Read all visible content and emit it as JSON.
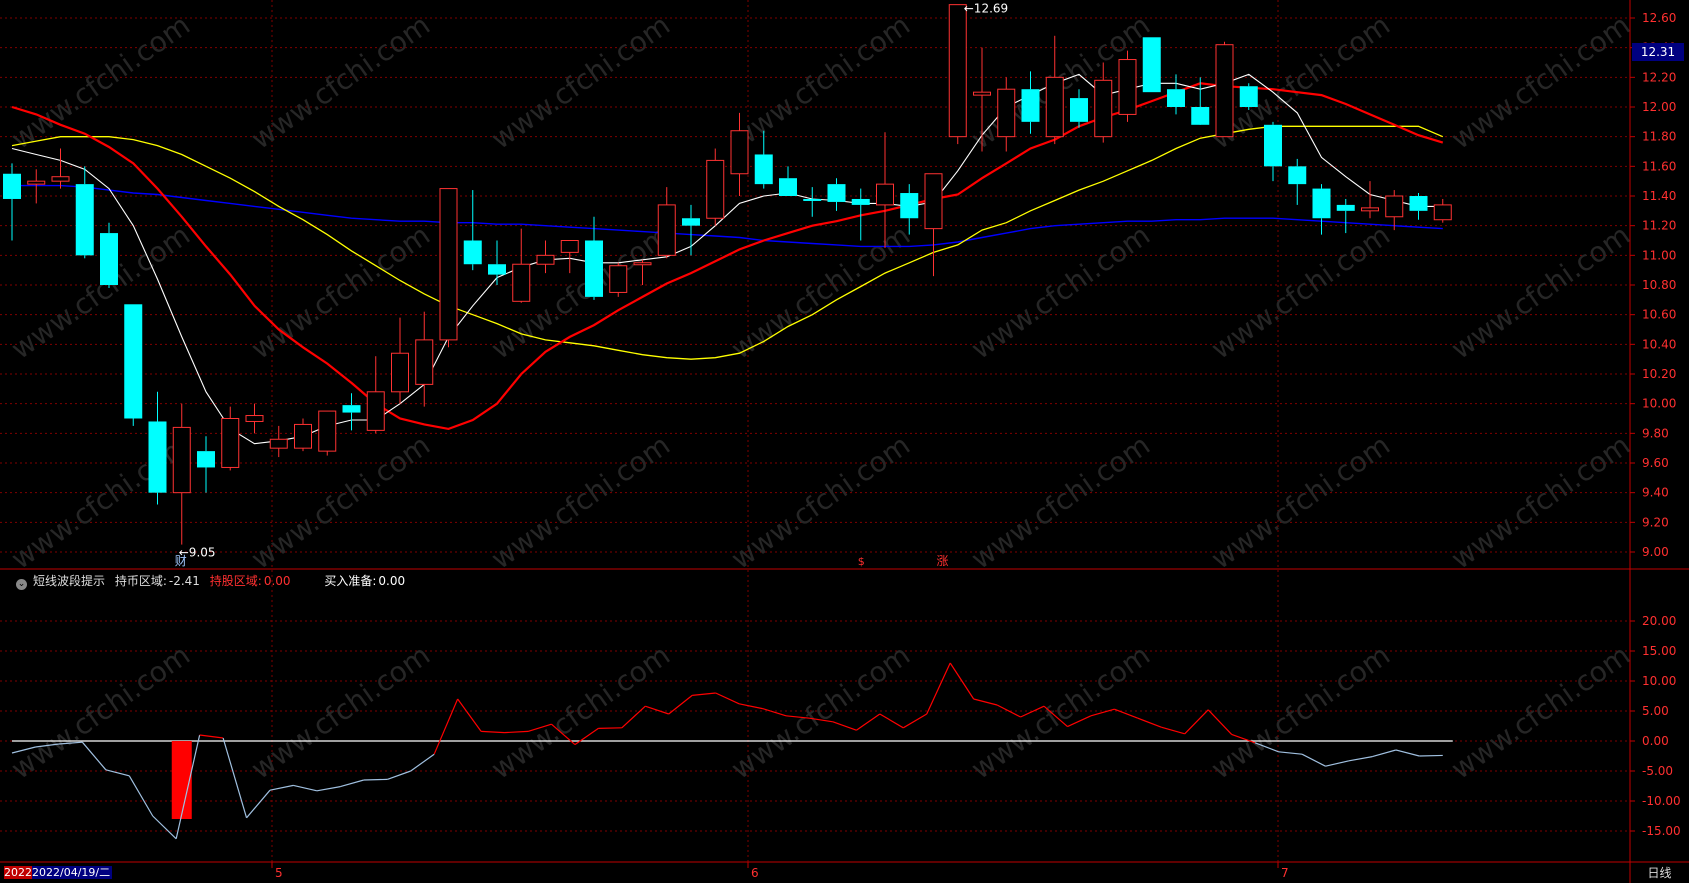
{
  "colors": {
    "up": "#ff3232",
    "down": "#00ffff",
    "ma5": "#ffffff",
    "ma10": "#ff0000",
    "ma20": "#ffff00",
    "ma60": "#0000ff",
    "grid": "#800000",
    "axis": "#c00000",
    "oscUp": "#ff0000",
    "oscDown": "#a0c0e0",
    "zero": "#ffffff",
    "bar": "#ff0000"
  },
  "price": {
    "last": "12.31",
    "max_label": "12.69",
    "min_label": "9.05",
    "ticks": [
      "12.60",
      "12.40",
      "12.20",
      "12.00",
      "11.80",
      "11.60",
      "11.40",
      "11.20",
      "11.00",
      "10.80",
      "10.60",
      "10.40",
      "10.20",
      "10.00",
      "9.80",
      "9.60",
      "9.40",
      "9.20",
      "9.00"
    ]
  },
  "indicator": {
    "name": "短线波段提示",
    "hold_coin_label": "持币区域:",
    "hold_coin_value": "-2.41",
    "hold_stock_label": "持股区域:",
    "hold_stock_value": "0.00",
    "buy_label": "买入准备:",
    "buy_value": "0.00",
    "ticks": [
      "20.00",
      "15.00",
      "10.00",
      "5.00",
      "0.00",
      "-5.00",
      "-10.00",
      "-15.00"
    ]
  },
  "bottom": {
    "year_fragment": "2022",
    "cursor_date": "2022/04/19/二",
    "months": [
      "5",
      "6",
      "7"
    ],
    "period": "日线"
  },
  "markers": {
    "cai": "财",
    "s": "$",
    "zhang": "涨"
  },
  "chart_data": [
    {
      "type": "candlestick",
      "title": "",
      "ylim": [
        9.0,
        12.7
      ],
      "ma_series": [
        "MA5",
        "MA10",
        "MA20",
        "MA60"
      ],
      "candles": [
        {
          "o": 11.55,
          "h": 11.62,
          "l": 11.1,
          "c": 11.38
        },
        {
          "o": 11.48,
          "h": 11.58,
          "l": 11.35,
          "c": 11.5
        },
        {
          "o": 11.5,
          "h": 11.72,
          "l": 11.45,
          "c": 11.53
        },
        {
          "o": 11.48,
          "h": 11.6,
          "l": 10.98,
          "c": 11.0
        },
        {
          "o": 11.15,
          "h": 11.22,
          "l": 10.78,
          "c": 10.8
        },
        {
          "o": 10.67,
          "h": 10.67,
          "l": 9.85,
          "c": 9.9
        },
        {
          "o": 9.88,
          "h": 10.08,
          "l": 9.32,
          "c": 9.4
        },
        {
          "o": 9.4,
          "h": 10.0,
          "l": 9.05,
          "c": 9.84
        },
        {
          "o": 9.68,
          "h": 9.78,
          "l": 9.4,
          "c": 9.57
        },
        {
          "o": 9.57,
          "h": 9.98,
          "l": 9.55,
          "c": 9.9
        },
        {
          "o": 9.88,
          "h": 10.0,
          "l": 9.8,
          "c": 9.92
        },
        {
          "o": 9.7,
          "h": 9.85,
          "l": 9.64,
          "c": 9.76
        },
        {
          "o": 9.7,
          "h": 9.9,
          "l": 9.68,
          "c": 9.86
        },
        {
          "o": 9.68,
          "h": 9.95,
          "l": 9.65,
          "c": 9.95
        },
        {
          "o": 9.99,
          "h": 10.07,
          "l": 9.82,
          "c": 9.94
        },
        {
          "o": 9.82,
          "h": 10.32,
          "l": 9.8,
          "c": 10.08
        },
        {
          "o": 10.08,
          "h": 10.58,
          "l": 10.0,
          "c": 10.34
        },
        {
          "o": 10.13,
          "h": 10.62,
          "l": 9.98,
          "c": 10.43
        },
        {
          "o": 10.43,
          "h": 11.45,
          "l": 10.38,
          "c": 11.45
        },
        {
          "o": 11.1,
          "h": 11.44,
          "l": 10.9,
          "c": 10.94
        },
        {
          "o": 10.94,
          "h": 11.1,
          "l": 10.8,
          "c": 10.87
        },
        {
          "o": 10.69,
          "h": 11.18,
          "l": 10.68,
          "c": 10.94
        },
        {
          "o": 10.94,
          "h": 11.1,
          "l": 10.88,
          "c": 11.0
        },
        {
          "o": 11.02,
          "h": 11.1,
          "l": 10.88,
          "c": 11.1
        },
        {
          "o": 11.1,
          "h": 11.26,
          "l": 10.7,
          "c": 10.72
        },
        {
          "o": 10.75,
          "h": 10.95,
          "l": 10.72,
          "c": 10.93
        },
        {
          "o": 10.95,
          "h": 10.97,
          "l": 10.8,
          "c": 10.95
        },
        {
          "o": 11.0,
          "h": 11.46,
          "l": 10.98,
          "c": 11.34
        },
        {
          "o": 11.25,
          "h": 11.34,
          "l": 11.0,
          "c": 11.2
        },
        {
          "o": 11.25,
          "h": 11.72,
          "l": 11.2,
          "c": 11.64
        },
        {
          "o": 11.55,
          "h": 11.96,
          "l": 11.4,
          "c": 11.84
        },
        {
          "o": 11.68,
          "h": 11.84,
          "l": 11.45,
          "c": 11.48
        },
        {
          "o": 11.52,
          "h": 11.6,
          "l": 11.4,
          "c": 11.4
        },
        {
          "o": 11.38,
          "h": 11.46,
          "l": 11.26,
          "c": 11.37
        },
        {
          "o": 11.48,
          "h": 11.52,
          "l": 11.3,
          "c": 11.36
        },
        {
          "o": 11.38,
          "h": 11.45,
          "l": 11.1,
          "c": 11.34
        },
        {
          "o": 11.34,
          "h": 11.83,
          "l": 11.05,
          "c": 11.48
        },
        {
          "o": 11.42,
          "h": 11.48,
          "l": 11.14,
          "c": 11.25
        },
        {
          "o": 11.18,
          "h": 11.55,
          "l": 10.86,
          "c": 11.55
        },
        {
          "o": 11.8,
          "h": 12.69,
          "l": 11.75,
          "c": 12.69
        },
        {
          "o": 12.08,
          "h": 12.4,
          "l": 11.7,
          "c": 12.1
        },
        {
          "o": 11.8,
          "h": 12.2,
          "l": 11.7,
          "c": 12.12
        },
        {
          "o": 12.12,
          "h": 12.24,
          "l": 11.82,
          "c": 11.9
        },
        {
          "o": 11.8,
          "h": 12.48,
          "l": 11.75,
          "c": 12.2
        },
        {
          "o": 12.06,
          "h": 12.12,
          "l": 11.86,
          "c": 11.9
        },
        {
          "o": 11.8,
          "h": 12.3,
          "l": 11.76,
          "c": 12.18
        },
        {
          "o": 11.95,
          "h": 12.38,
          "l": 11.9,
          "c": 12.32
        },
        {
          "o": 12.47,
          "h": 12.47,
          "l": 12.1,
          "c": 12.1
        },
        {
          "o": 12.12,
          "h": 12.22,
          "l": 11.95,
          "c": 12.0
        },
        {
          "o": 12.0,
          "h": 12.2,
          "l": 11.9,
          "c": 11.88
        },
        {
          "o": 11.8,
          "h": 12.44,
          "l": 11.8,
          "c": 12.42
        },
        {
          "o": 12.14,
          "h": 12.16,
          "l": 11.98,
          "c": 12.0
        },
        {
          "o": 11.88,
          "h": 11.9,
          "l": 11.5,
          "c": 11.6
        },
        {
          "o": 11.6,
          "h": 11.65,
          "l": 11.34,
          "c": 11.48
        },
        {
          "o": 11.45,
          "h": 11.48,
          "l": 11.14,
          "c": 11.25
        },
        {
          "o": 11.34,
          "h": 11.38,
          "l": 11.15,
          "c": 11.3
        },
        {
          "o": 11.3,
          "h": 11.5,
          "l": 11.25,
          "c": 11.32
        },
        {
          "o": 11.26,
          "h": 11.44,
          "l": 11.17,
          "c": 11.4
        },
        {
          "o": 11.4,
          "h": 11.42,
          "l": 11.24,
          "c": 11.3
        },
        {
          "o": 11.24,
          "h": 11.38,
          "l": 11.22,
          "c": 11.34
        }
      ],
      "ma5": [
        11.72,
        11.68,
        11.64,
        11.58,
        11.45,
        11.2,
        10.84,
        10.45,
        10.08,
        9.83,
        9.73,
        9.75,
        9.78,
        9.85,
        9.89,
        9.89,
        10.0,
        10.13,
        10.45,
        10.66,
        10.85,
        10.92,
        10.97,
        10.98,
        10.95,
        10.95,
        10.97,
        10.99,
        11.06,
        11.2,
        11.35,
        11.4,
        11.42,
        11.38,
        11.37,
        11.35,
        11.35,
        11.33,
        11.36,
        11.57,
        11.81,
        12.0,
        12.08,
        12.16,
        12.22,
        12.08,
        12.12,
        12.16,
        12.16,
        12.12,
        12.16,
        12.22,
        12.1,
        11.96,
        11.66,
        11.53,
        11.41,
        11.37,
        11.33,
        11.33
      ],
      "ma10": [
        12.0,
        11.95,
        11.88,
        11.82,
        11.73,
        11.62,
        11.45,
        11.26,
        11.06,
        10.87,
        10.66,
        10.5,
        10.38,
        10.27,
        10.14,
        10.0,
        9.9,
        9.86,
        9.83,
        9.89,
        10.0,
        10.2,
        10.35,
        10.45,
        10.53,
        10.63,
        10.72,
        10.81,
        10.88,
        10.96,
        11.04,
        11.1,
        11.15,
        11.2,
        11.23,
        11.27,
        11.3,
        11.34,
        11.38,
        11.41,
        11.52,
        11.62,
        11.72,
        11.78,
        11.87,
        11.93,
        11.98,
        12.04,
        12.1,
        12.16,
        12.14,
        12.13,
        12.12,
        12.1,
        12.08,
        12.02,
        11.95,
        11.88,
        11.81,
        11.76
      ],
      "ma20": [
        11.74,
        11.77,
        11.8,
        11.8,
        11.8,
        11.78,
        11.74,
        11.68,
        11.6,
        11.52,
        11.43,
        11.33,
        11.24,
        11.14,
        11.03,
        10.93,
        10.83,
        10.74,
        10.66,
        10.6,
        10.54,
        10.47,
        10.43,
        10.41,
        10.39,
        10.36,
        10.33,
        10.31,
        10.3,
        10.31,
        10.34,
        10.42,
        10.52,
        10.6,
        10.7,
        10.79,
        10.88,
        10.95,
        11.02,
        11.07,
        11.17,
        11.22,
        11.3,
        11.37,
        11.44,
        11.5,
        11.57,
        11.64,
        11.72,
        11.79,
        11.82,
        11.85,
        11.87,
        11.87,
        11.87,
        11.87,
        11.87,
        11.87,
        11.87,
        11.8
      ],
      "ma60": [
        11.47,
        11.47,
        11.47,
        11.46,
        11.44,
        11.42,
        11.41,
        11.39,
        11.37,
        11.35,
        11.33,
        11.31,
        11.29,
        11.27,
        11.25,
        11.24,
        11.23,
        11.23,
        11.22,
        11.22,
        11.21,
        11.21,
        11.2,
        11.19,
        11.18,
        11.17,
        11.16,
        11.15,
        11.14,
        11.13,
        11.12,
        11.1,
        11.09,
        11.08,
        11.07,
        11.06,
        11.06,
        11.06,
        11.07,
        11.09,
        11.12,
        11.15,
        11.18,
        11.2,
        11.21,
        11.22,
        11.23,
        11.23,
        11.24,
        11.24,
        11.25,
        11.25,
        11.25,
        11.24,
        11.23,
        11.22,
        11.21,
        11.2,
        11.19,
        11.18
      ]
    },
    {
      "type": "line",
      "title": "",
      "ylim": [
        -18,
        24
      ],
      "series": [
        {
          "name": "持币区域",
          "values": [
            -2,
            -1,
            -0.5,
            -0.2,
            -4.8,
            -5.8,
            -12.5,
            -16.3,
            1,
            0.5,
            -12.8,
            -8.2,
            -7.4,
            -8.3,
            -7.6,
            -6.5,
            -6.4,
            -5,
            -2.2,
            7,
            1.6,
            1.4,
            1.6,
            2.8,
            -0.6,
            2.1,
            2.2,
            5.8,
            4.5,
            7.6,
            8,
            6.2,
            5.4,
            4.2,
            3.8,
            3.2,
            1.8,
            4.5,
            2.2,
            4.5,
            13,
            7,
            6,
            4,
            5.8,
            2.4,
            4.2,
            5.3,
            3.8,
            2.3,
            1.2,
            5.2,
            1.1,
            -0.3,
            -1.8,
            -2.2,
            -4.2,
            -3.3,
            -2.6,
            -1.5,
            -2.5,
            -2.41
          ]
        }
      ],
      "bars": [
        {
          "index": 7,
          "value": -13.0
        }
      ]
    }
  ]
}
